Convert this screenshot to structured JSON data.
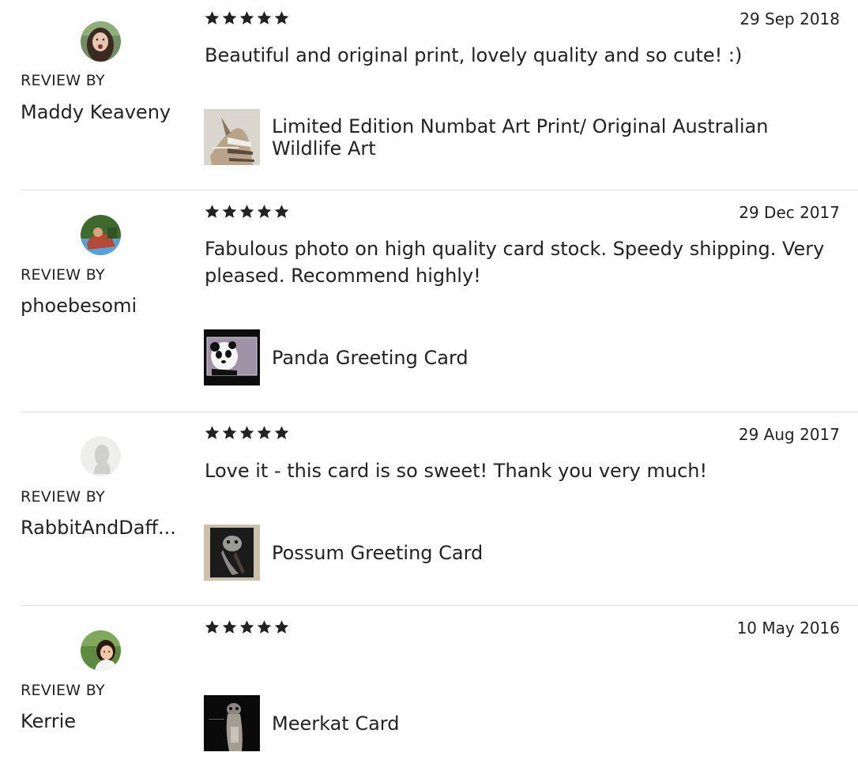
{
  "reviews": [
    {
      "rating": 5,
      "date": "29 Sep 2018",
      "review_by_label": "REVIEW BY",
      "reviewer": "Maddy Keaveny",
      "text": "Beautiful and original print, lovely quality and so cute! :)",
      "item_title": "Limited Edition Numbat Art Print/ Original Australian Wildlife Art"
    },
    {
      "rating": 5,
      "date": "29 Dec 2017",
      "review_by_label": "REVIEW BY",
      "reviewer": "phoebesomi",
      "text": "Fabulous photo on high quality card stock. Speedy shipping. Very pleased. Recommend highly!",
      "item_title": "Panda Greeting Card"
    },
    {
      "rating": 5,
      "date": "29 Aug 2017",
      "review_by_label": "REVIEW BY",
      "reviewer": "RabbitAndDaff...",
      "text": "Love it - this card is so sweet! Thank you very much!",
      "item_title": "Possum Greeting Card"
    },
    {
      "rating": 5,
      "date": "10 May 2016",
      "review_by_label": "REVIEW BY",
      "reviewer": "Kerrie",
      "text": "",
      "item_title": "Meerkat Card"
    }
  ],
  "icons": {
    "star": "star-icon",
    "avatar": "user-avatar",
    "default_avatar": "default-user-silhouette-icon"
  },
  "colors": {
    "text": "#222222",
    "star": "#222222",
    "divider": "#e1e3df"
  }
}
